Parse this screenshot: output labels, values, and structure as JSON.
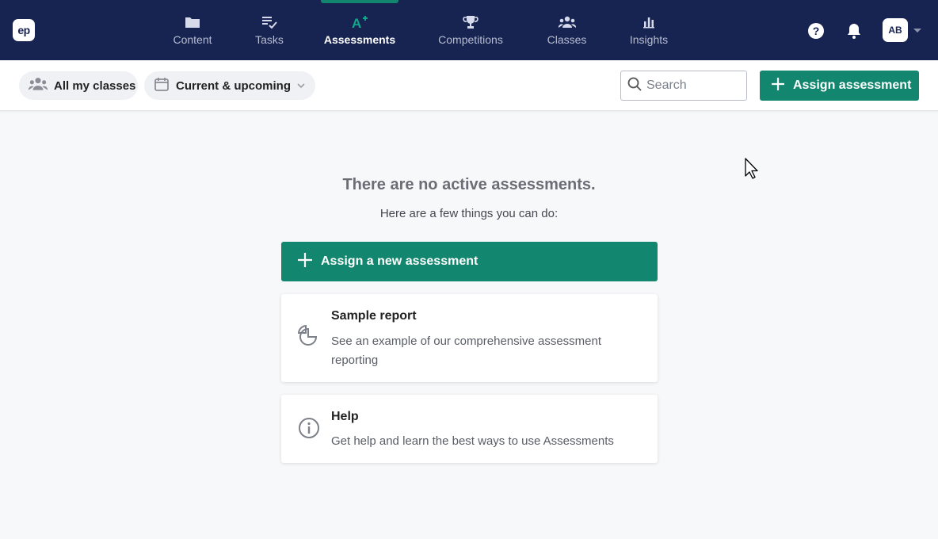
{
  "brand": {
    "logo_text": "ep"
  },
  "nav": {
    "items": [
      {
        "label": "Content",
        "icon": "folder-icon"
      },
      {
        "label": "Tasks",
        "icon": "tasks-icon"
      },
      {
        "label": "Assessments",
        "icon": "assessment-icon",
        "active": true
      },
      {
        "label": "Competitions",
        "icon": "trophy-icon"
      },
      {
        "label": "Classes",
        "icon": "people-icon"
      },
      {
        "label": "Insights",
        "icon": "bar-chart-icon"
      }
    ],
    "help_icon": "help-icon",
    "bell_icon": "bell-icon",
    "avatar_initials": "AB"
  },
  "toolbar": {
    "class_filter_label": "All my classes",
    "date_filter_label": "Current & upcoming",
    "search_placeholder": "Search",
    "assign_button_label": "Assign assessment"
  },
  "empty_state": {
    "title": "There are no active assessments.",
    "subtitle": "Here are a few things you can do:",
    "cta_label": "Assign a new assessment",
    "cards": [
      {
        "title": "Sample report",
        "description": "See an example of our comprehensive assessment reporting",
        "icon": "pie-chart-icon"
      },
      {
        "title": "Help",
        "description": "Get help and learn the best ways to use Assessments",
        "icon": "info-icon"
      }
    ]
  },
  "colors": {
    "nav_bg": "#172350",
    "accent": "#12866f",
    "page_bg": "#f7f8fa"
  }
}
